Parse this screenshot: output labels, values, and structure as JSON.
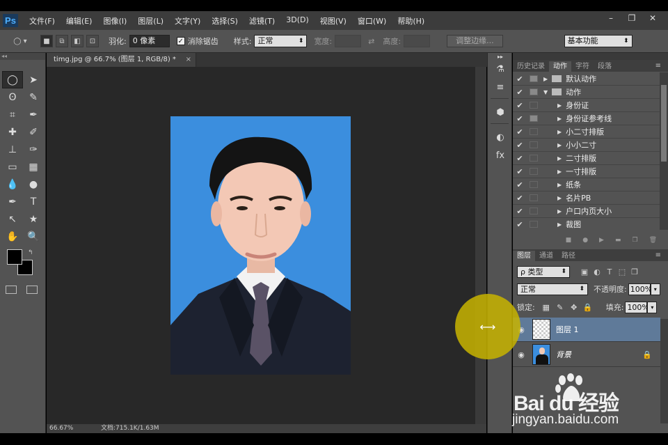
{
  "app": {
    "logo": "Ps",
    "menus": [
      "文件(F)",
      "编辑(E)",
      "图像(I)",
      "图层(L)",
      "文字(Y)",
      "选择(S)",
      "滤镜(T)",
      "3D(D)",
      "视图(V)",
      "窗口(W)",
      "帮助(H)"
    ],
    "window_controls": [
      "–",
      "❐",
      "✕"
    ]
  },
  "options": {
    "feather_label": "羽化:",
    "feather_value": "0 像素",
    "antialias_label": "消除锯齿",
    "antialias_checked": true,
    "style_label": "样式:",
    "style_value": "正常",
    "width_label": "宽度:",
    "height_label": "高度:",
    "refine_edge": "调整边缘...",
    "workspace": "基本功能"
  },
  "document": {
    "tab_title": "timg.jpg @ 66.7% (图层 1, RGB/8) *",
    "zoom": "66.67%",
    "doc_info": "文档:715.1K/1.63M"
  },
  "actions_panel": {
    "tabs": [
      "历史记录",
      "动作",
      "字符",
      "段落"
    ],
    "active_tab": "动作",
    "items": [
      {
        "label": "默认动作",
        "type": "set",
        "dialog": true,
        "expanded": false
      },
      {
        "label": "动作",
        "type": "set",
        "dialog": true,
        "expanded": true
      },
      {
        "label": "身份证",
        "type": "action",
        "dialog": false
      },
      {
        "label": "身份证参考线",
        "type": "action",
        "dialog": true
      },
      {
        "label": "小二寸排版",
        "type": "action",
        "dialog": false
      },
      {
        "label": "小小二寸",
        "type": "action",
        "dialog": false
      },
      {
        "label": "二寸排版",
        "type": "action",
        "dialog": false
      },
      {
        "label": "一寸排版",
        "type": "action",
        "dialog": false
      },
      {
        "label": "纸条",
        "type": "action",
        "dialog": false
      },
      {
        "label": "名片PB",
        "type": "action",
        "dialog": false
      },
      {
        "label": "户口内页大小",
        "type": "action",
        "dialog": false
      },
      {
        "label": "裁图",
        "type": "action",
        "dialog": false
      }
    ]
  },
  "layers_panel": {
    "tabs": [
      "图层",
      "通道",
      "路径"
    ],
    "active_tab": "图层",
    "kind_filter": "ρ 类型",
    "blend_mode": "正常",
    "opacity_label": "不透明度:",
    "opacity_value": "100%",
    "lock_label": "锁定:",
    "fill_label": "填充:",
    "fill_value": "100%",
    "layers": [
      {
        "name": "图层 1",
        "selected": true,
        "thumb": "transparent",
        "locked": false
      },
      {
        "name": "背景",
        "selected": false,
        "thumb": "photo",
        "locked": true
      }
    ]
  },
  "watermark": {
    "brand": "Bai du 经验",
    "url": "jingyan.baidu.com"
  },
  "colors": {
    "photo_bg": "#3b8ede",
    "selected_layer": "#5f7a99",
    "highlight": "#c8b400"
  }
}
